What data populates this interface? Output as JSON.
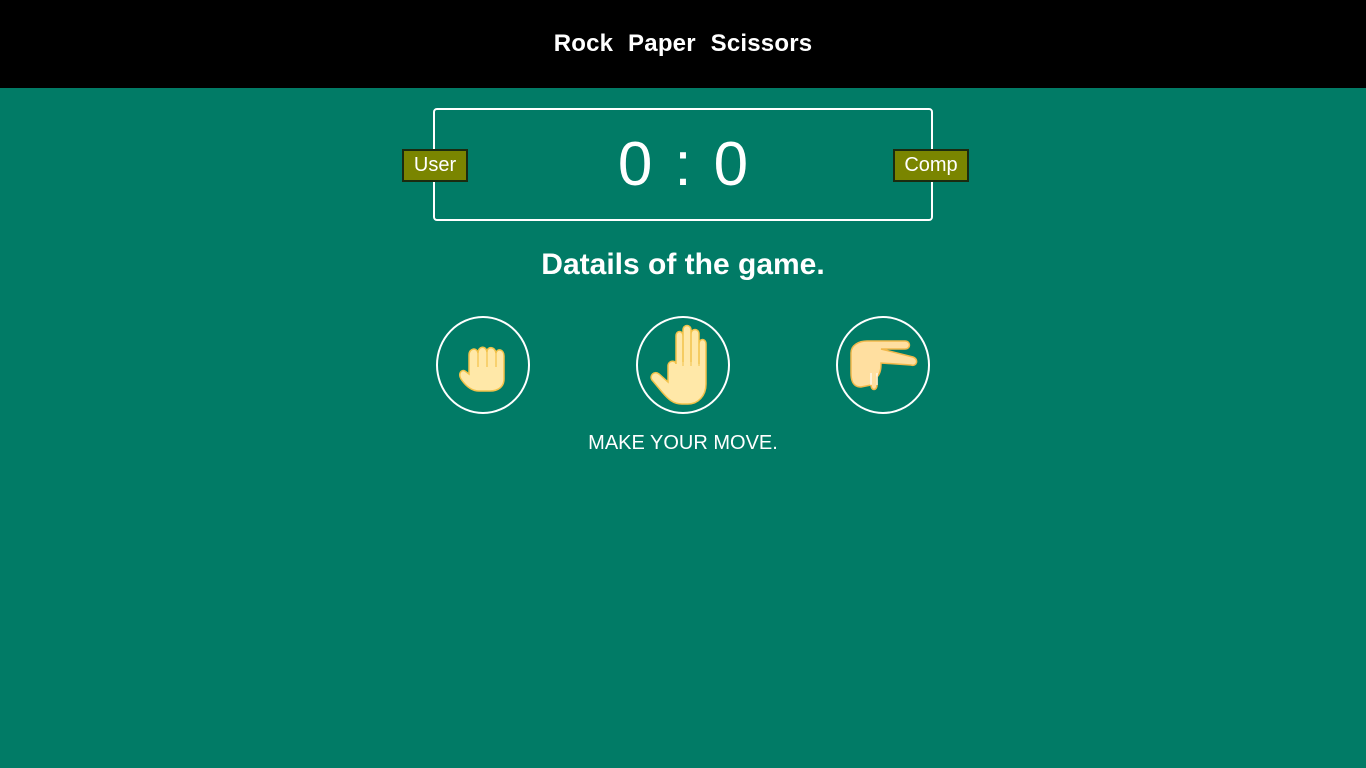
{
  "header": {
    "title": "Rock  Paper  Scissors"
  },
  "scoreboard": {
    "user_label": "User",
    "comp_label": "Comp",
    "user_score": "0",
    "separator": ":",
    "comp_score": "0"
  },
  "details": "Datails of the game.",
  "choices": [
    {
      "name": "rock",
      "icon": "fist-hand-icon"
    },
    {
      "name": "paper",
      "icon": "open-hand-icon"
    },
    {
      "name": "scissors",
      "icon": "two-fingers-hand-icon"
    }
  ],
  "message": "MAKE YOUR MOVE.",
  "colors": {
    "background": "#017b66",
    "header": "#000000",
    "badge": "#7a8500",
    "skin": "#ffe8a8",
    "skin_outline": "#f2c24a"
  }
}
